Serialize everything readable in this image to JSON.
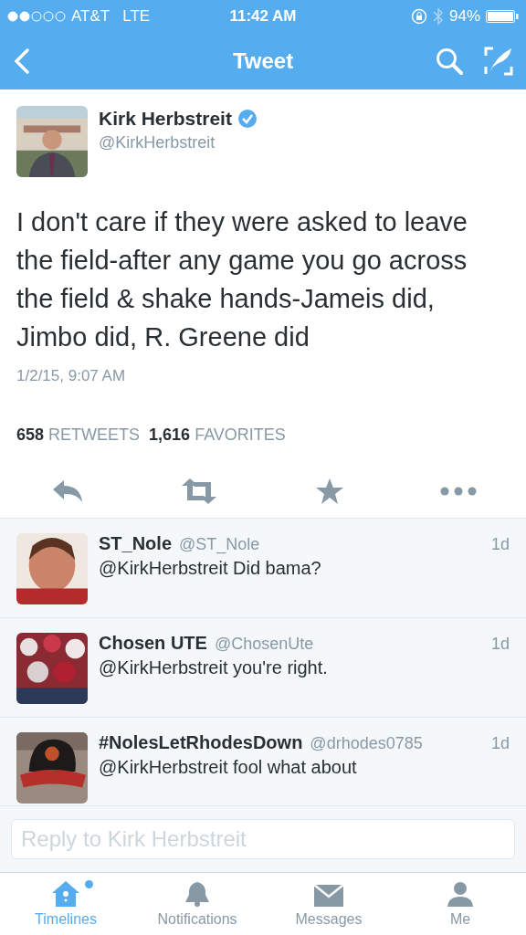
{
  "status_bar": {
    "carrier": "AT&T",
    "network": "LTE",
    "time": "11:42 AM",
    "battery": "94%"
  },
  "nav": {
    "title": "Tweet"
  },
  "tweet": {
    "name": "Kirk Herbstreit",
    "verified": true,
    "handle": "@KirkHerbstreit",
    "text": "I don't care if they were asked to leave the field-after any game you go across the field & shake hands-Jameis did, Jimbo did, R. Greene did",
    "date": "1/2/15, 9:07 AM",
    "stats": [
      {
        "count": "658",
        "label": "RETWEETS"
      },
      {
        "count": "1,616",
        "label": "FAVORITES"
      }
    ]
  },
  "replies": [
    {
      "name": "ST_Nole",
      "handle": "@ST_Nole",
      "time": "1d",
      "text": "@KirkHerbstreit Did bama?"
    },
    {
      "name": "Chosen UTE",
      "handle": "@ChosenUte",
      "time": "1d",
      "text": "@KirkHerbstreit you're right."
    },
    {
      "name": "#NolesLetRhodesDown",
      "handle": "@drhodes0785",
      "time": "1d",
      "text": "@KirkHerbstreit fool what about"
    }
  ],
  "reply_field": {
    "placeholder": "Reply to Kirk Herbstreit"
  },
  "tabs": [
    {
      "label": "Timelines",
      "selected": true,
      "unread": true
    },
    {
      "label": "Notifications",
      "selected": false,
      "unread": false
    },
    {
      "label": "Messages",
      "selected": false,
      "unread": false
    },
    {
      "label": "Me",
      "selected": false,
      "unread": false
    }
  ]
}
